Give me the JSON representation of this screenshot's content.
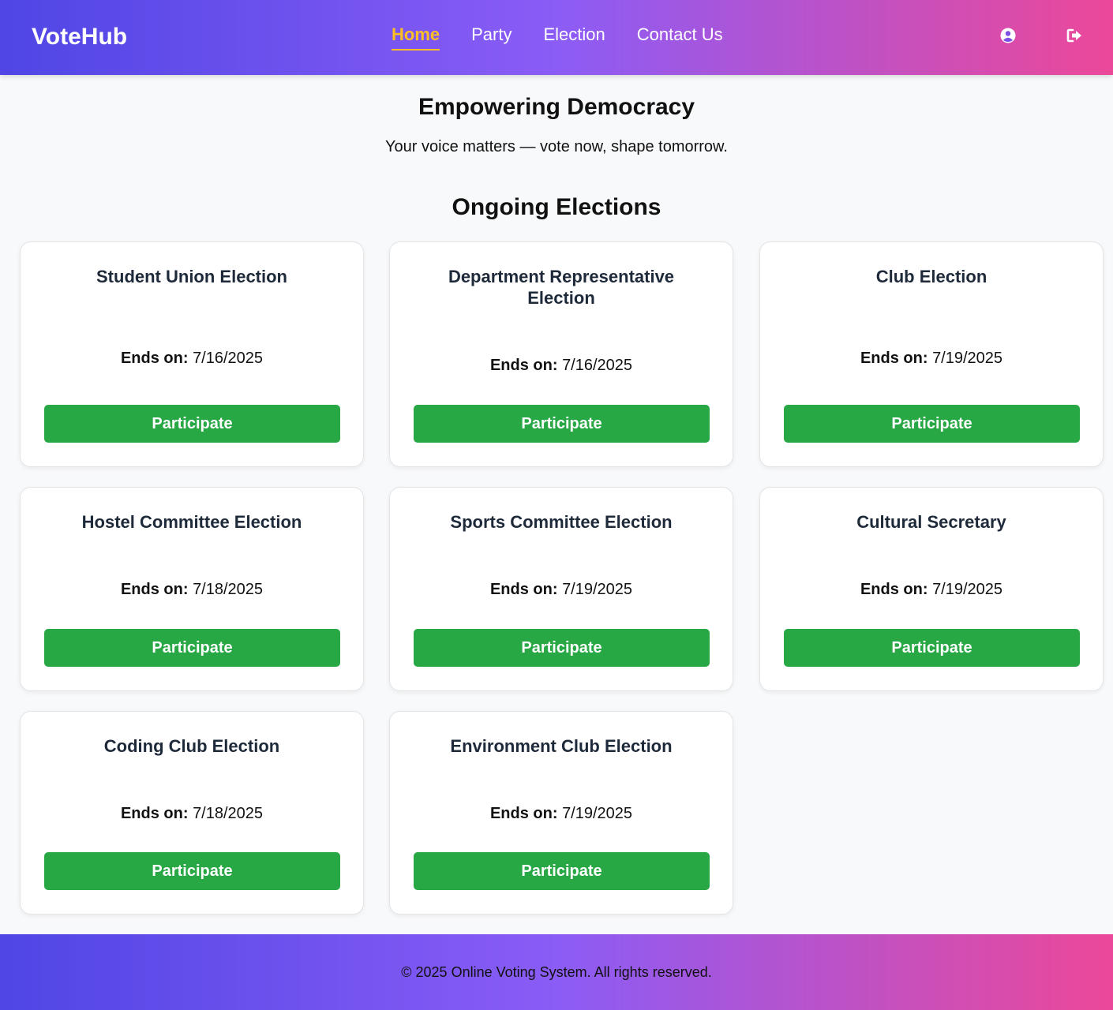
{
  "brand": "VoteHub",
  "nav": {
    "links": [
      {
        "label": "Home",
        "active": true
      },
      {
        "label": "Party",
        "active": false
      },
      {
        "label": "Election",
        "active": false
      },
      {
        "label": "Contact Us",
        "active": false
      }
    ],
    "icons": [
      "user-circle-icon",
      "logout-icon"
    ]
  },
  "hero": {
    "title": "Empowering Democracy",
    "subtitle": "Your voice matters — vote now, shape tomorrow."
  },
  "section_title": "Ongoing Elections",
  "date_label": "Ends on:",
  "button_label": "Participate",
  "elections": [
    {
      "title": "Student Union Election",
      "ends": "7/16/2025"
    },
    {
      "title": "Department Representative Election",
      "ends": "7/16/2025"
    },
    {
      "title": "Club Election",
      "ends": "7/19/2025"
    },
    {
      "title": "Hostel Committee Election",
      "ends": "7/18/2025"
    },
    {
      "title": "Sports Committee Election",
      "ends": "7/19/2025"
    },
    {
      "title": "Cultural Secretary",
      "ends": "7/19/2025"
    },
    {
      "title": "Coding Club Election",
      "ends": "7/18/2025"
    },
    {
      "title": "Environment Club Election",
      "ends": "7/19/2025"
    }
  ],
  "footer": "© 2025 Online Voting System. All rights reserved.",
  "colors": {
    "gradient_start": "#4f46e5",
    "gradient_mid": "#8b5cf6",
    "gradient_end": "#ec4899",
    "active_nav": "#fbbf24",
    "button": "#28a745"
  }
}
